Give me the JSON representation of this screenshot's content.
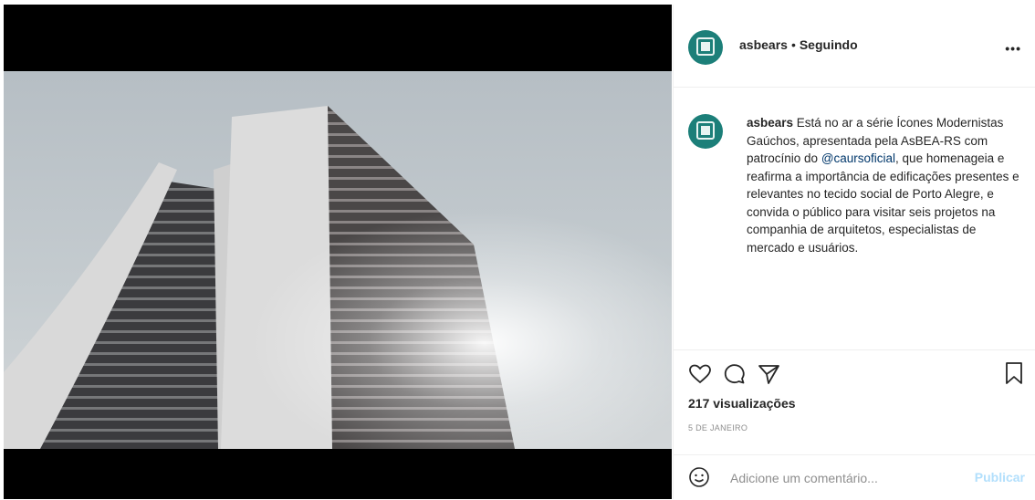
{
  "post": {
    "username": "asbears",
    "separator": "•",
    "follow_status": "Seguindo",
    "more_label": "•••",
    "caption": {
      "username": "asbears",
      "text_before_mention": " Está no ar a série Ícones Modernistas Gaúchos, apresentada pela AsBEA-RS com patrocínio do ",
      "mention": "@caursoficial",
      "text_after_mention": ", que homenageia e reafirma a importância de edificações presentes e relevantes no tecido social de Porto Alegre, e convida o público para visitar seis projetos na companhia de arquitetos, especialistas de mercado e usuários."
    },
    "views": "217 visualizações",
    "date": "5 DE JANEIRO"
  },
  "comment": {
    "placeholder": "Adicione um comentário...",
    "publish_label": "Publicar"
  },
  "icons": {
    "like": "heart-icon",
    "comment": "comment-icon",
    "share": "share-icon",
    "save": "bookmark-icon",
    "mute": "speaker-muted-icon",
    "emoji": "smiley-icon"
  },
  "colors": {
    "brand_avatar": "#1c7f79",
    "mention": "#00376b",
    "publish_disabled": "#b2dffc"
  }
}
